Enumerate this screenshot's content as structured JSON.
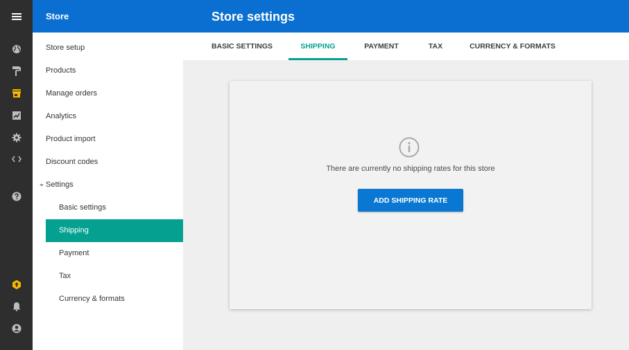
{
  "header": {
    "store_label": "Store",
    "page_title": "Store settings"
  },
  "rail": {
    "icons": [
      "menu-icon",
      "globe-icon",
      "paint-roller-icon",
      "store-icon",
      "chart-icon",
      "gear-icon",
      "code-icon",
      "help-icon",
      "upgrade-icon",
      "bell-icon",
      "account-icon"
    ]
  },
  "sidebar": {
    "items": [
      {
        "label": "Store setup"
      },
      {
        "label": "Products"
      },
      {
        "label": "Manage orders"
      },
      {
        "label": "Analytics"
      },
      {
        "label": "Product import"
      },
      {
        "label": "Discount codes"
      },
      {
        "label": "Settings",
        "expanded": true
      }
    ],
    "sub_items": [
      {
        "label": "Basic settings"
      },
      {
        "label": "Shipping",
        "active": true
      },
      {
        "label": "Payment"
      },
      {
        "label": "Tax"
      },
      {
        "label": "Currency & formats"
      }
    ]
  },
  "tabs": [
    {
      "label": "BASIC SETTINGS"
    },
    {
      "label": "SHIPPING",
      "active": true
    },
    {
      "label": "PAYMENT"
    },
    {
      "label": "TAX"
    },
    {
      "label": "CURRENCY & FORMATS"
    }
  ],
  "empty_state": {
    "icon": "info-icon",
    "message": "There are currently no shipping rates for this store",
    "button_label": "ADD SHIPPING RATE"
  },
  "colors": {
    "header_bg": "#0a6fd0",
    "rail_bg": "#2e2e2e",
    "accent_teal": "#04a191",
    "button_blue": "#0a78d2",
    "upgrade_yellow": "#f5b800"
  }
}
